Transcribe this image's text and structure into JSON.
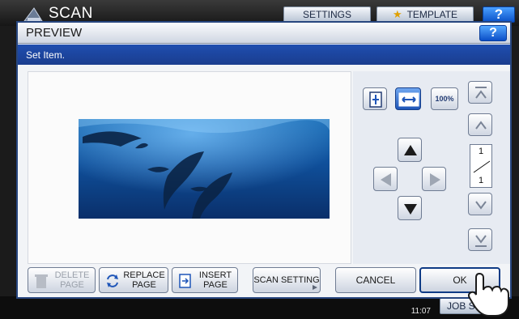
{
  "app": {
    "title": "SCAN",
    "settings_label": "SETTINGS",
    "template_label": "TEMPLATE",
    "help_label": "?",
    "clock_date": "",
    "clock_time": "11:07",
    "jobs_label": "JOB S"
  },
  "dialog": {
    "title": "PREVIEW",
    "help_label": "?",
    "message": "Set Item."
  },
  "preview": {
    "image_subject": "dolphins-underwater"
  },
  "controls": {
    "zoom_fit_icon": "fit-page-icon",
    "zoom_width_icon": "fit-width-icon",
    "zoom_100_label": "100%",
    "pan_icons": [
      "arrow-up-icon",
      "arrow-left-icon",
      "arrow-right-icon",
      "arrow-down-icon"
    ]
  },
  "pagination": {
    "current": "1",
    "total": "1"
  },
  "footer": {
    "delete_page_label": "DELETE\nPAGE",
    "replace_page_label": "REPLACE\nPAGE",
    "insert_page_label": "INSERT\nPAGE",
    "scan_setting_label": "SCAN SETTING",
    "cancel_label": "CANCEL",
    "ok_label": "OK"
  },
  "colors": {
    "accent": "#1f4eb0",
    "dialog_border": "#27467f",
    "active_control": "#1e55b8"
  }
}
